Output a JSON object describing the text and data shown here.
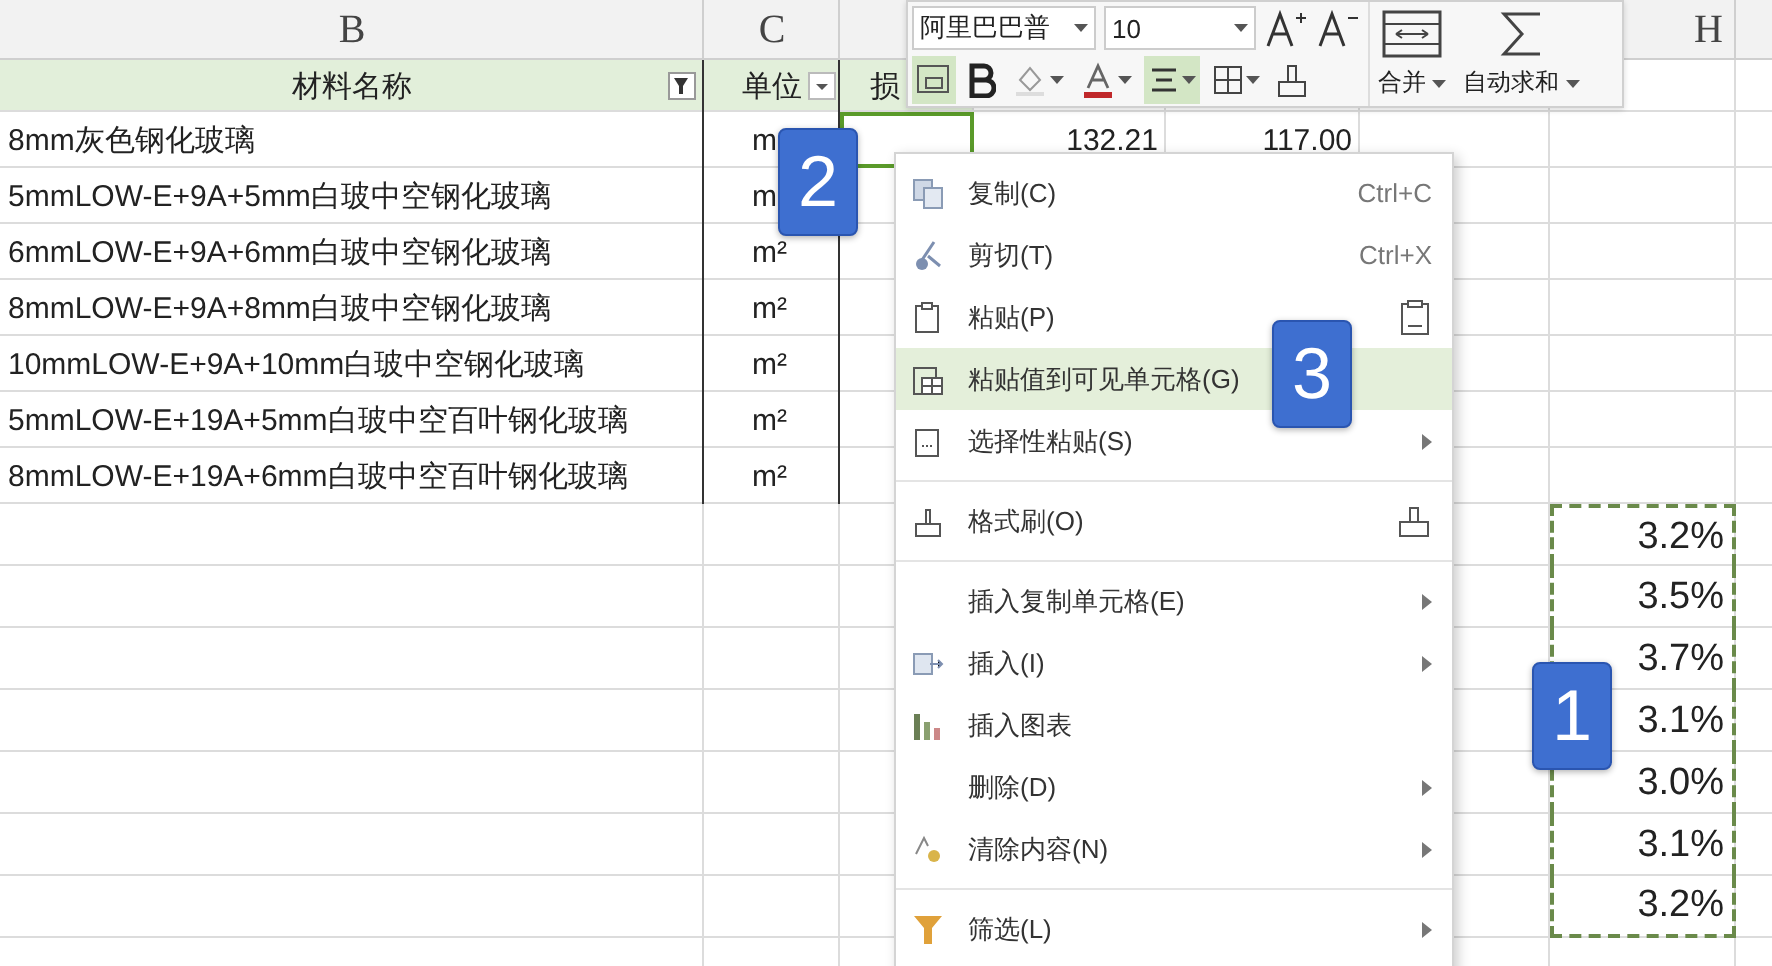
{
  "columns": [
    "B",
    "C",
    null,
    null,
    null,
    null,
    "H",
    null
  ],
  "table": {
    "header": [
      "材料名称",
      "单位",
      "损"
    ],
    "rows": [
      {
        "cells": [
          "8mm灰色钢化玻璃",
          "m",
          null,
          "132.21",
          "117.00",
          null,
          null,
          null
        ],
        "active": true,
        "copied": false
      },
      {
        "cells": [
          "5mmLOW-E+9A+5mm白玻中空钢化玻璃",
          "m",
          null,
          null,
          null,
          null,
          null,
          null
        ],
        "active": false,
        "copied": false
      },
      {
        "cells": [
          "6mmLOW-E+9A+6mm白玻中空钢化玻璃",
          "m²",
          null,
          null,
          null,
          null,
          null,
          null
        ],
        "active": false,
        "copied": false
      },
      {
        "cells": [
          "8mmLOW-E+9A+8mm白玻中空钢化玻璃",
          "m²",
          null,
          null,
          null,
          null,
          null,
          null
        ],
        "active": false,
        "copied": false
      },
      {
        "cells": [
          "10mmLOW-E+9A+10mm白玻中空钢化玻璃",
          "m²",
          null,
          null,
          null,
          null,
          null,
          null
        ],
        "active": false,
        "copied": false
      },
      {
        "cells": [
          "5mmLOW-E+19A+5mm白玻中空百叶钢化玻璃",
          "m²",
          null,
          null,
          null,
          null,
          null,
          null
        ],
        "active": false,
        "copied": false
      },
      {
        "cells": [
          "8mmLOW-E+19A+6mm白玻中空百叶钢化玻璃",
          "m²",
          null,
          null,
          null,
          null,
          null,
          null
        ],
        "active": false,
        "copied": false
      },
      {
        "cells": [
          null,
          null,
          null,
          null,
          null,
          null,
          "3.2%",
          null
        ],
        "active": false,
        "copied": true
      },
      {
        "cells": [
          null,
          null,
          null,
          null,
          null,
          null,
          "3.5%",
          null
        ],
        "active": false,
        "copied": true
      },
      {
        "cells": [
          null,
          null,
          null,
          null,
          null,
          null,
          "3.7%",
          null
        ],
        "active": false,
        "copied": true
      },
      {
        "cells": [
          null,
          null,
          null,
          null,
          null,
          null,
          "3.1%",
          null
        ],
        "active": false,
        "copied": true
      },
      {
        "cells": [
          null,
          null,
          null,
          null,
          null,
          null,
          "3.0%",
          null
        ],
        "active": false,
        "copied": true
      },
      {
        "cells": [
          null,
          null,
          null,
          null,
          null,
          null,
          "3.1%",
          null
        ],
        "active": false,
        "copied": true
      },
      {
        "cells": [
          null,
          null,
          null,
          null,
          null,
          null,
          "3.2%",
          null
        ],
        "active": false,
        "copied": true
      },
      {
        "cells": [
          null,
          null,
          null,
          null,
          null,
          null,
          null,
          null
        ],
        "active": false,
        "copied": false
      }
    ]
  },
  "mini_toolbar": {
    "font": "阿里巴巴普",
    "size": "10",
    "merge": "合并",
    "autosum": "自动求和",
    "align_selected": true
  },
  "context_menu": [
    {
      "kind": "item",
      "label": "复制(C)",
      "shortcut": "Ctrl+C",
      "submenu": false,
      "selected": false
    },
    {
      "kind": "item",
      "label": "剪切(T)",
      "shortcut": "Ctrl+X",
      "submenu": false,
      "selected": false
    },
    {
      "kind": "item",
      "label": "粘贴(P)",
      "submenu": false,
      "selected": false
    },
    {
      "kind": "item",
      "label": "粘贴值到可见单元格(G)",
      "submenu": false,
      "selected": true
    },
    {
      "kind": "item",
      "label": "选择性粘贴(S)",
      "submenu": true,
      "selected": false
    },
    {
      "kind": "separator"
    },
    {
      "kind": "item",
      "label": "格式刷(O)",
      "submenu": false,
      "selected": false
    },
    {
      "kind": "separator"
    },
    {
      "kind": "item",
      "label": "插入复制单元格(E)",
      "submenu": true,
      "selected": false
    },
    {
      "kind": "item",
      "label": "插入(I)",
      "submenu": true,
      "selected": false
    },
    {
      "kind": "item",
      "label": "插入图表",
      "submenu": false,
      "selected": false
    },
    {
      "kind": "item",
      "label": "删除(D)",
      "submenu": true,
      "selected": false
    },
    {
      "kind": "item",
      "label": "清除内容(N)",
      "submenu": true,
      "selected": false
    },
    {
      "kind": "separator"
    },
    {
      "kind": "item",
      "label": "筛选(L)",
      "submenu": true,
      "selected": false
    }
  ],
  "step_badges": [
    "2",
    "3",
    "1"
  ]
}
